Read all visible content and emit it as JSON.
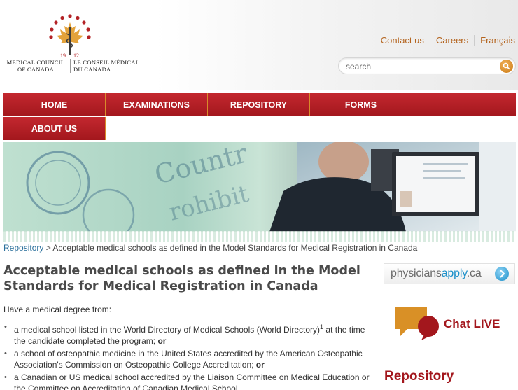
{
  "logo": {
    "name_en_line1": "MEDICAL COUNCIL",
    "name_en_line2": "OF CANADA",
    "name_fr_line1": "LE CONSEIL MÉDICAL",
    "name_fr_line2": "DU CANADA",
    "year_left": "19",
    "year_right": "12"
  },
  "top_links": [
    "Contact us",
    "Careers",
    "Français"
  ],
  "search": {
    "placeholder": "search",
    "icon": "search-icon"
  },
  "nav": {
    "home": "HOME",
    "examinations": "EXAMINATIONS",
    "repository": "REPOSITORY",
    "forms": "FORMS",
    "about_us": "ABOUT US"
  },
  "breadcrumb": {
    "root": "Repository",
    "separator": ">",
    "current": "Acceptable medical schools as defined in the Model Standards for Medical Registration in Canada"
  },
  "page": {
    "title": "Acceptable medical schools as defined in the Model Standards for Medical Registration in Canada",
    "intro": "Have a medical degree from:",
    "list": [
      {
        "text_a": "a medical school listed in the World Directory of Medical Schools (World Directory)",
        "sup": "1",
        "text_b": " at the time the candidate completed the program; ",
        "conj": "or"
      },
      {
        "text_a": "a school of osteopathic medicine in the United States accredited by the American Osteopathic Association's Commission on Osteopathic College Accreditation; ",
        "conj": "or"
      },
      {
        "text_a": "a Canadian or US medical school accredited by the Liaison Committee on Medical Education or the Committee on Accreditation of Canadian Medical School"
      }
    ]
  },
  "sidebar": {
    "physicians_apply": {
      "part1": "physicians",
      "part2": "apply",
      "part3": ".ca"
    },
    "chat_label": "Chat LIVE",
    "repository_heading": "Repository"
  },
  "colors": {
    "brand_red": "#a3171d",
    "link_orange": "#b4641e",
    "link_blue": "#2a6f9b",
    "accent_blue": "#1a8fc9"
  }
}
